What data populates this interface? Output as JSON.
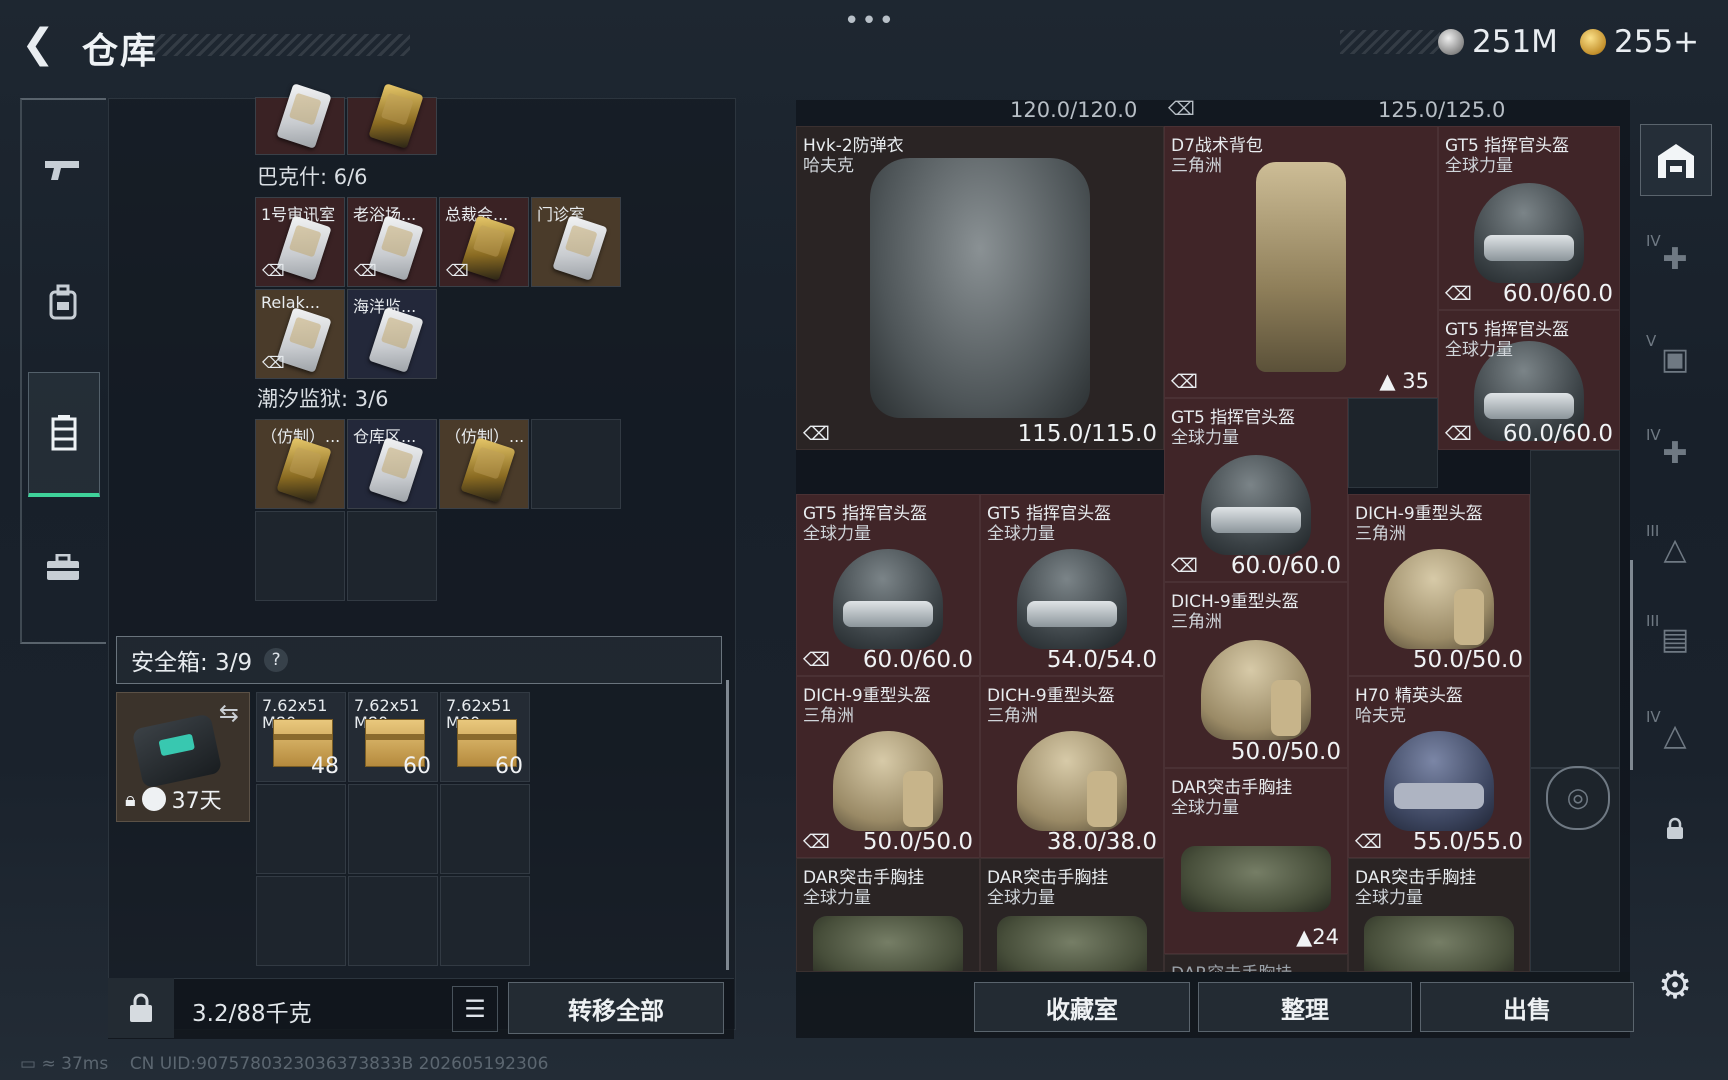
{
  "header": {
    "back_icon": "chevron-left-icon",
    "title": "仓库",
    "more": "•••",
    "currency": [
      {
        "icon": "silver-coin-icon",
        "value": "251M"
      },
      {
        "icon": "gold-coin-icon",
        "value": "255+"
      }
    ]
  },
  "left_nav": [
    {
      "icon": "pistol-icon",
      "label": "weapons"
    },
    {
      "icon": "backpack-icon",
      "label": "gear"
    },
    {
      "icon": "storage-icon",
      "label": "storage",
      "active": true
    },
    {
      "icon": "briefcase-icon",
      "label": "case"
    }
  ],
  "keycards": {
    "sections": [
      {
        "title": "巴克什: 6/6",
        "items": [
          "1号审讯室",
          "老浴场...",
          "总裁会...",
          "门诊室",
          "Relak...",
          "海洋监..."
        ]
      },
      {
        "title": "潮汐监狱: 3/6",
        "items": [
          "（仿制）...",
          "仓库区...",
          "（仿制）..."
        ]
      }
    ],
    "no_insure_icon": "no-insure-icon"
  },
  "safebox": {
    "label": "安全箱:  3/9",
    "help": "?",
    "days": "37天",
    "ammo": [
      {
        "name": "7.62x51",
        "sub": "M80",
        "count": "48"
      },
      {
        "name": "7.62x51",
        "sub": "M80",
        "count": "60"
      },
      {
        "name": "7.62x51",
        "sub": "M80",
        "count": "60"
      }
    ]
  },
  "left_footer": {
    "weight": "3.2/88千克",
    "transfer_all": "转移全部"
  },
  "stash_header": {
    "cap1": "120.0/120.0",
    "cap2": "125.0/125.0"
  },
  "items": [
    {
      "id": "vest",
      "name": "Hvk-2防弹衣",
      "sub": "哈夫克",
      "dur": "115.0/115.0"
    },
    {
      "id": "pack",
      "name": "D7战术背包",
      "sub": "三角洲",
      "cap": "35"
    },
    {
      "id": "h1",
      "name": "GT5 指挥官头盔",
      "sub": "全球力量",
      "dur": "60.0/60.0"
    },
    {
      "id": "h2",
      "name": "GT5 指挥官头盔",
      "sub": "全球力量",
      "dur": "60.0/60.0"
    },
    {
      "id": "h3",
      "name": "GT5 指挥官头盔",
      "sub": "全球力量",
      "dur": "60.0/60.0"
    },
    {
      "id": "h4",
      "name": "GT5 指挥官头盔",
      "sub": "全球力量",
      "dur": "60.0/60.0"
    },
    {
      "id": "h5",
      "name": "GT5 指挥官头盔",
      "sub": "全球力量",
      "dur": "54.0/54.0"
    },
    {
      "id": "h6",
      "name": "DICH-9重型头盔",
      "sub": "三角洲",
      "dur": "50.0/50.0"
    },
    {
      "id": "h7",
      "name": "DICH-9重型头盔",
      "sub": "三角洲",
      "dur": "50.0/50.0"
    },
    {
      "id": "h8",
      "name": "DICH-9重型头盔",
      "sub": "三角洲",
      "dur": "50.0/50.0"
    },
    {
      "id": "h9",
      "name": "DICH-9重型头盔",
      "sub": "三角洲",
      "dur": "38.0/38.0"
    },
    {
      "id": "h10",
      "name": "H70 精英头盔",
      "sub": "哈夫克",
      "dur": "55.0/55.0"
    },
    {
      "id": "r1",
      "name": "DAR突击手胸挂",
      "sub": "全球力量",
      "cap": "24"
    },
    {
      "id": "r2",
      "name": "DAR突击手胸挂",
      "sub": "全球力量"
    },
    {
      "id": "r3",
      "name": "DAR突击手胸挂",
      "sub": "全球力量"
    },
    {
      "id": "r4",
      "name": "DAR突击手胸挂",
      "sub": "全球力量"
    },
    {
      "id": "r5",
      "name": "DAR突击手胸挂",
      "sub": ""
    }
  ],
  "right_footer": {
    "btn1": "收藏室",
    "btn2": "整理",
    "btn3": "出售"
  },
  "right_nav": [
    {
      "icon": "warehouse-icon",
      "roman": ""
    },
    {
      "icon": "medkit-icon",
      "roman": "IV"
    },
    {
      "icon": "safe-icon",
      "roman": "V"
    },
    {
      "icon": "medkit-icon",
      "roman": "IV"
    },
    {
      "icon": "tech-icon",
      "roman": "III"
    },
    {
      "icon": "gun-rack-icon",
      "roman": "III"
    },
    {
      "icon": "tech-icon",
      "roman": "IV"
    },
    {
      "icon": "lock-icon",
      "roman": ""
    },
    {
      "icon": "gear-icon",
      "roman": ""
    }
  ],
  "status": {
    "ping": "37ms",
    "uid": "CN UID:9075780323036373833B 202605192306"
  }
}
